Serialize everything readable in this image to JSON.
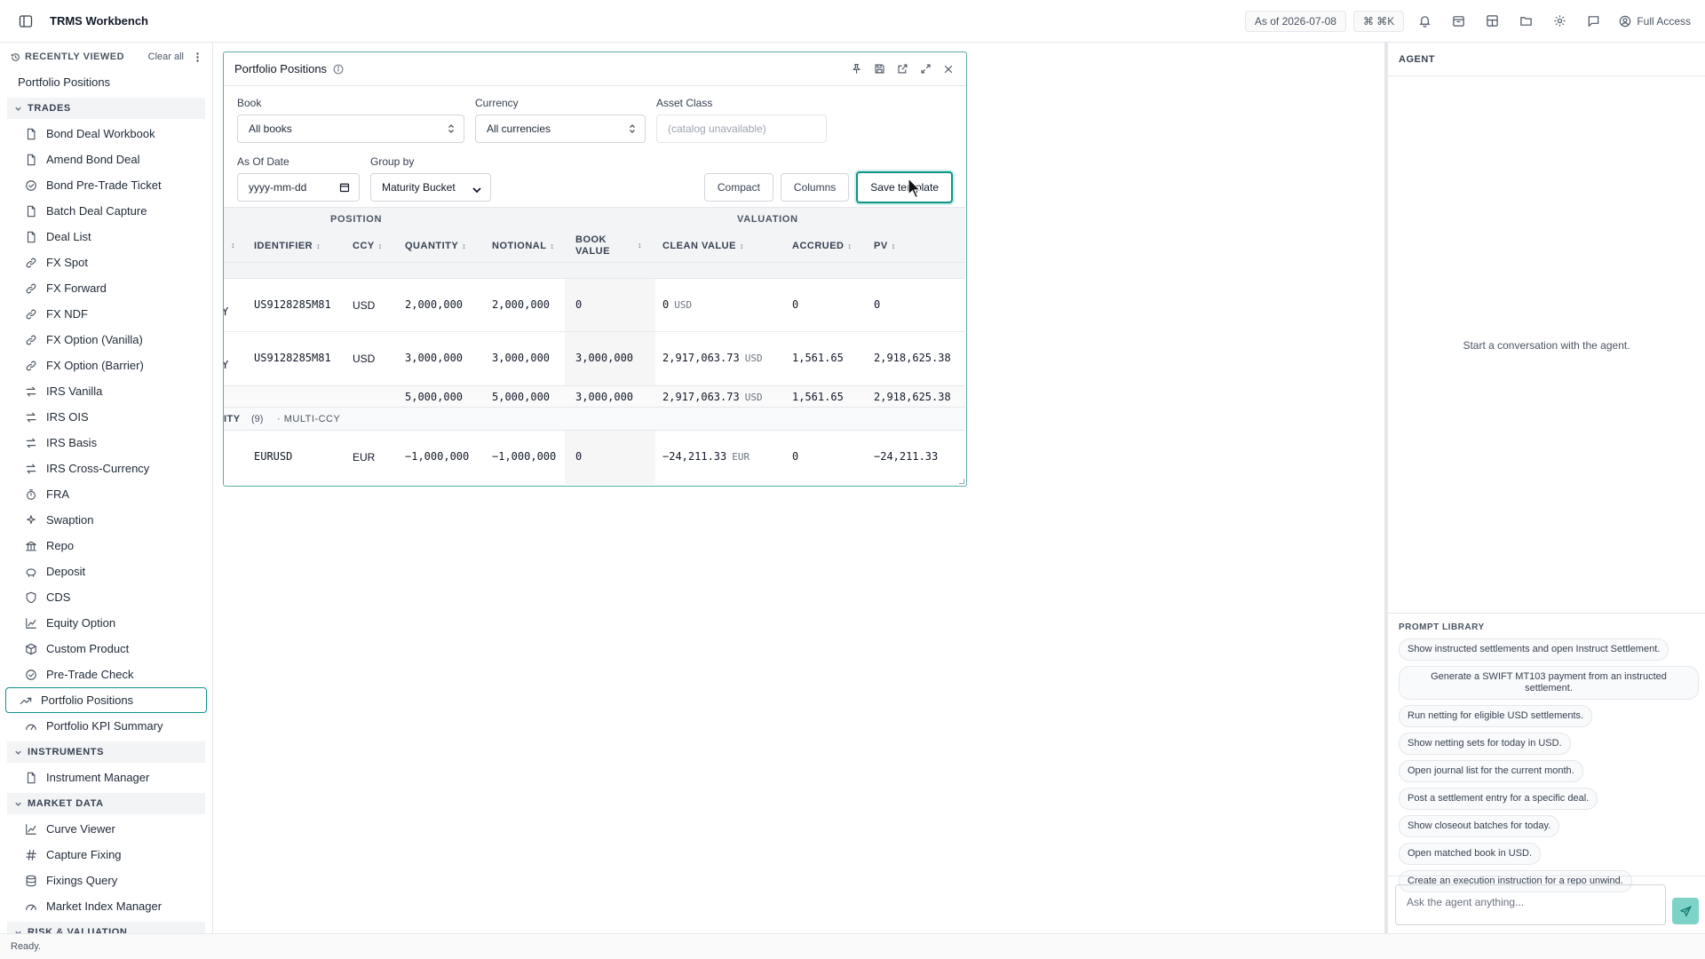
{
  "topbar": {
    "app_title": "TRMS Workbench",
    "as_of": "As of 2026-07-08",
    "shortcut": "⌘ ⌘K",
    "access": "Full Access"
  },
  "sidebar": {
    "recently_viewed_label": "RECENTLY VIEWED",
    "clear_all": "Clear all",
    "recent_items": [
      "Portfolio Positions"
    ],
    "sections": [
      {
        "title": "TRADES",
        "items": [
          {
            "label": "Bond Deal Workbook",
            "icon": "document-icon"
          },
          {
            "label": "Amend Bond Deal",
            "icon": "document-icon"
          },
          {
            "label": "Bond Pre-Trade Ticket",
            "icon": "check-circle-icon"
          },
          {
            "label": "Batch Deal Capture",
            "icon": "document-icon"
          },
          {
            "label": "Deal List",
            "icon": "document-icon"
          },
          {
            "label": "FX Spot",
            "icon": "link-icon"
          },
          {
            "label": "FX Forward",
            "icon": "link-icon"
          },
          {
            "label": "FX NDF",
            "icon": "link-icon"
          },
          {
            "label": "FX Option (Vanilla)",
            "icon": "link-icon"
          },
          {
            "label": "FX Option (Barrier)",
            "icon": "link-icon"
          },
          {
            "label": "IRS Vanilla",
            "icon": "swap-icon"
          },
          {
            "label": "IRS OIS",
            "icon": "swap-icon"
          },
          {
            "label": "IRS Basis",
            "icon": "swap-icon"
          },
          {
            "label": "IRS Cross-Currency",
            "icon": "swap-icon"
          },
          {
            "label": "FRA",
            "icon": "timer-icon"
          },
          {
            "label": "Swaption",
            "icon": "sparkle-icon"
          },
          {
            "label": "Repo",
            "icon": "bank-icon"
          },
          {
            "label": "Deposit",
            "icon": "piggy-bank-icon"
          },
          {
            "label": "CDS",
            "icon": "shield-icon"
          },
          {
            "label": "Equity Option",
            "icon": "line-chart-icon"
          },
          {
            "label": "Custom Product",
            "icon": "package-icon"
          },
          {
            "label": "Pre-Trade Check",
            "icon": "check-circle-icon"
          },
          {
            "label": "Portfolio Positions",
            "icon": "trend-up-icon",
            "active": true
          },
          {
            "label": "Portfolio KPI Summary",
            "icon": "gauge-icon"
          }
        ]
      },
      {
        "title": "INSTRUMENTS",
        "items": [
          {
            "label": "Instrument Manager",
            "icon": "document-icon"
          }
        ]
      },
      {
        "title": "MARKET DATA",
        "items": [
          {
            "label": "Curve Viewer",
            "icon": "line-chart-icon"
          },
          {
            "label": "Capture Fixing",
            "icon": "hash-icon"
          },
          {
            "label": "Fixings Query",
            "icon": "database-icon"
          },
          {
            "label": "Market Index Manager",
            "icon": "gauge-icon"
          }
        ]
      },
      {
        "title": "RISK & VALUATION",
        "items": []
      }
    ]
  },
  "panel": {
    "title": "Portfolio Positions",
    "filters": {
      "book_label": "Book",
      "book_value": "All books",
      "currency_label": "Currency",
      "currency_value": "All currencies",
      "asset_class_label": "Asset Class",
      "asset_class_placeholder": "(catalog unavailable)",
      "as_of_label": "As Of Date",
      "as_of_placeholder": "yyyy-mm-dd",
      "group_by_label": "Group by",
      "group_by_value": "Maturity Bucket"
    },
    "buttons": {
      "compact": "Compact",
      "columns": "Columns",
      "save_template": "Save template"
    },
    "table": {
      "group_headers": {
        "position": "POSITION",
        "valuation": "VALUATION"
      },
      "columns": [
        "IDENTIFIER",
        "CCY",
        "QUANTITY",
        "NOTIONAL",
        "BOOK VALUE",
        "CLEAN VALUE",
        "ACCRUED",
        "PV"
      ],
      "book_value_line1": "BOOK",
      "book_value_line2": "VALUE",
      "rows": [
        {
          "lead": "Y",
          "identifier": "US9128285M81",
          "ccy": "USD",
          "quantity": "2,000,000",
          "notional": "2,000,000",
          "book_value": "0",
          "clean_value": "0",
          "clean_ccy": "USD",
          "accrued": "0",
          "pv": "0"
        },
        {
          "lead": "Y",
          "identifier": "US9128285M81",
          "ccy": "USD",
          "quantity": "3,000,000",
          "notional": "3,000,000",
          "book_value": "3,000,000",
          "clean_value": "2,917,063.73",
          "clean_ccy": "USD",
          "accrued": "1,561.65",
          "pv": "2,918,625.38"
        }
      ],
      "subtotal": {
        "quantity": "5,000,000",
        "notional": "5,000,000",
        "book_value": "3,000,000",
        "clean_value": "2,917,063.73",
        "clean_ccy": "USD",
        "accrued": "1,561.65",
        "pv": "2,918,625.38"
      },
      "group2": {
        "label": "ITY",
        "count": "(9)",
        "tag": "· MULTI-CCY"
      },
      "row3": {
        "identifier": "EURUSD",
        "ccy": "EUR",
        "quantity": "−1,000,000",
        "notional": "−1,000,000",
        "book_value": "0",
        "clean_value": "−24,211.33",
        "clean_ccy": "EUR",
        "accrued": "0",
        "pv": "−24,211.33"
      }
    }
  },
  "agent": {
    "title": "AGENT",
    "empty_message": "Start a conversation with the agent.",
    "prompt_library_title": "PROMPT LIBRARY",
    "prompts": [
      "Show instructed settlements and open Instruct Settlement.",
      "Generate a SWIFT MT103 payment from an instructed settlement.",
      "Run netting for eligible USD settlements.",
      "Show netting sets for today in USD.",
      "Open journal list for the current month.",
      "Post a settlement entry for a specific deal.",
      "Show closeout batches for today.",
      "Open matched book in USD.",
      "Create an execution instruction for a repo unwind."
    ],
    "input_placeholder": "Ask the agent anything..."
  },
  "status": {
    "text": "Ready."
  },
  "colors": {
    "accent": "#0d9488",
    "border": "#e5e7eb",
    "send_button": "#7dd3c8"
  }
}
